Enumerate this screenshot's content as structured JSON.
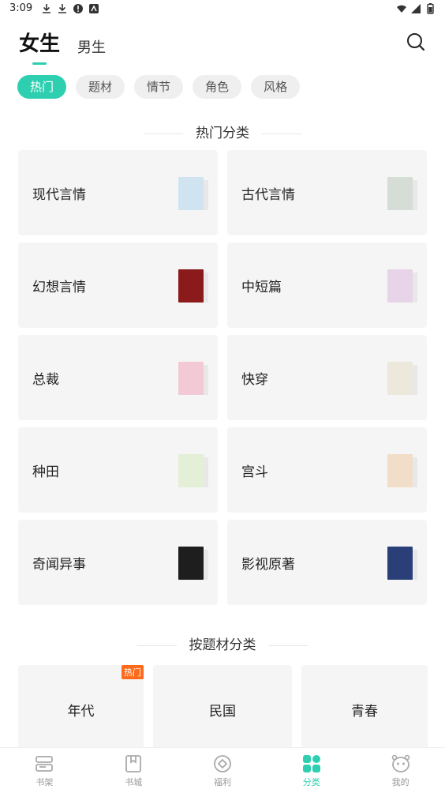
{
  "status": {
    "time": "3:09"
  },
  "top_tabs": [
    {
      "label": "女生",
      "active": true
    },
    {
      "label": "男生",
      "active": false
    }
  ],
  "chips": [
    {
      "label": "热门",
      "active": true
    },
    {
      "label": "题材",
      "active": false
    },
    {
      "label": "情节",
      "active": false
    },
    {
      "label": "角色",
      "active": false
    },
    {
      "label": "风格",
      "active": false
    }
  ],
  "hot_section": {
    "title": "热门分类",
    "cards": [
      {
        "label": "现代言情",
        "cover_color": "#cfe3f0"
      },
      {
        "label": "古代言情",
        "cover_color": "#d6ddd6"
      },
      {
        "label": "幻想言情",
        "cover_color": "#8b1a1a"
      },
      {
        "label": "中短篇",
        "cover_color": "#e8d4e8"
      },
      {
        "label": "总裁",
        "cover_color": "#f3c9d6"
      },
      {
        "label": "快穿",
        "cover_color": "#ece9dc"
      },
      {
        "label": "种田",
        "cover_color": "#e4efd8"
      },
      {
        "label": "宫斗",
        "cover_color": "#f1ddc8"
      },
      {
        "label": "奇闻异事",
        "cover_color": "#1e1e1e"
      },
      {
        "label": "影视原著",
        "cover_color": "#2a3e78"
      }
    ]
  },
  "theme_section": {
    "title": "按题材分类",
    "cards": [
      {
        "label": "年代",
        "badge": "热门"
      },
      {
        "label": "民国",
        "badge": ""
      },
      {
        "label": "青春",
        "badge": ""
      }
    ]
  },
  "bottom_nav": [
    {
      "label": "书架",
      "icon": "bookshelf-icon",
      "active": false
    },
    {
      "label": "书城",
      "icon": "bookstore-icon",
      "active": false
    },
    {
      "label": "福利",
      "icon": "welfare-icon",
      "active": false
    },
    {
      "label": "分类",
      "icon": "category-icon",
      "active": true
    },
    {
      "label": "我的",
      "icon": "profile-icon",
      "active": false
    }
  ],
  "colors": {
    "accent": "#2ecfb0",
    "hot_badge": "#ff6a1a",
    "card_bg": "#f5f5f5"
  }
}
